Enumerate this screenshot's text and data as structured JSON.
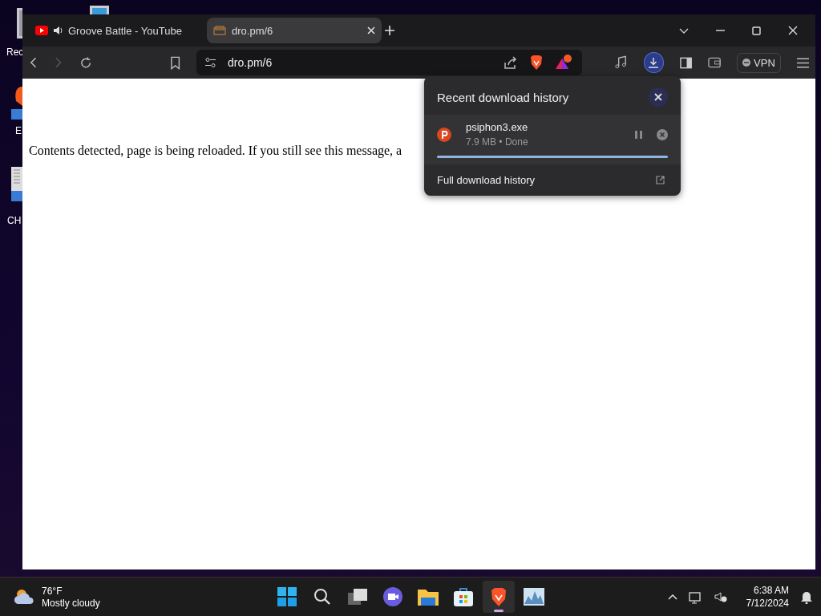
{
  "desktop_icons": [
    {
      "label": "Rec",
      "kind": "bin"
    },
    {
      "label": "E",
      "kind": "browser"
    },
    {
      "label": "CH",
      "kind": "file"
    }
  ],
  "tabs": [
    {
      "title": "Groove Battle - YouTube",
      "selected": false,
      "audio": true,
      "kind": "video"
    },
    {
      "title": "dro.pm/6",
      "selected": true,
      "audio": false,
      "kind": "page"
    }
  ],
  "address_bar": {
    "url": "dro.pm/6"
  },
  "toolbar": {
    "vpn_label": "VPN"
  },
  "page": {
    "message": "Contents detected, page is being reloaded. If you still see this message, a"
  },
  "download_panel": {
    "title": "Recent download history",
    "items": [
      {
        "filename": "psiphon3.exe",
        "details": "7.9 MB • Done",
        "level": 1
      }
    ],
    "footer_link": "Full download history"
  },
  "taskbar": {
    "weather": {
      "temperature": "76°F",
      "condition": "Mostly cloudy"
    },
    "apps": [
      {
        "kind": "start",
        "selected": false
      },
      {
        "kind": "search",
        "selected": false
      },
      {
        "kind": "taskview",
        "selected": false
      },
      {
        "kind": "meet",
        "selected": false
      },
      {
        "kind": "folder",
        "selected": false
      },
      {
        "kind": "store",
        "selected": false
      },
      {
        "kind": "brave",
        "selected": true
      },
      {
        "kind": "monitor",
        "selected": false
      }
    ],
    "time": "6:38 AM",
    "date": "7/12/2024"
  }
}
